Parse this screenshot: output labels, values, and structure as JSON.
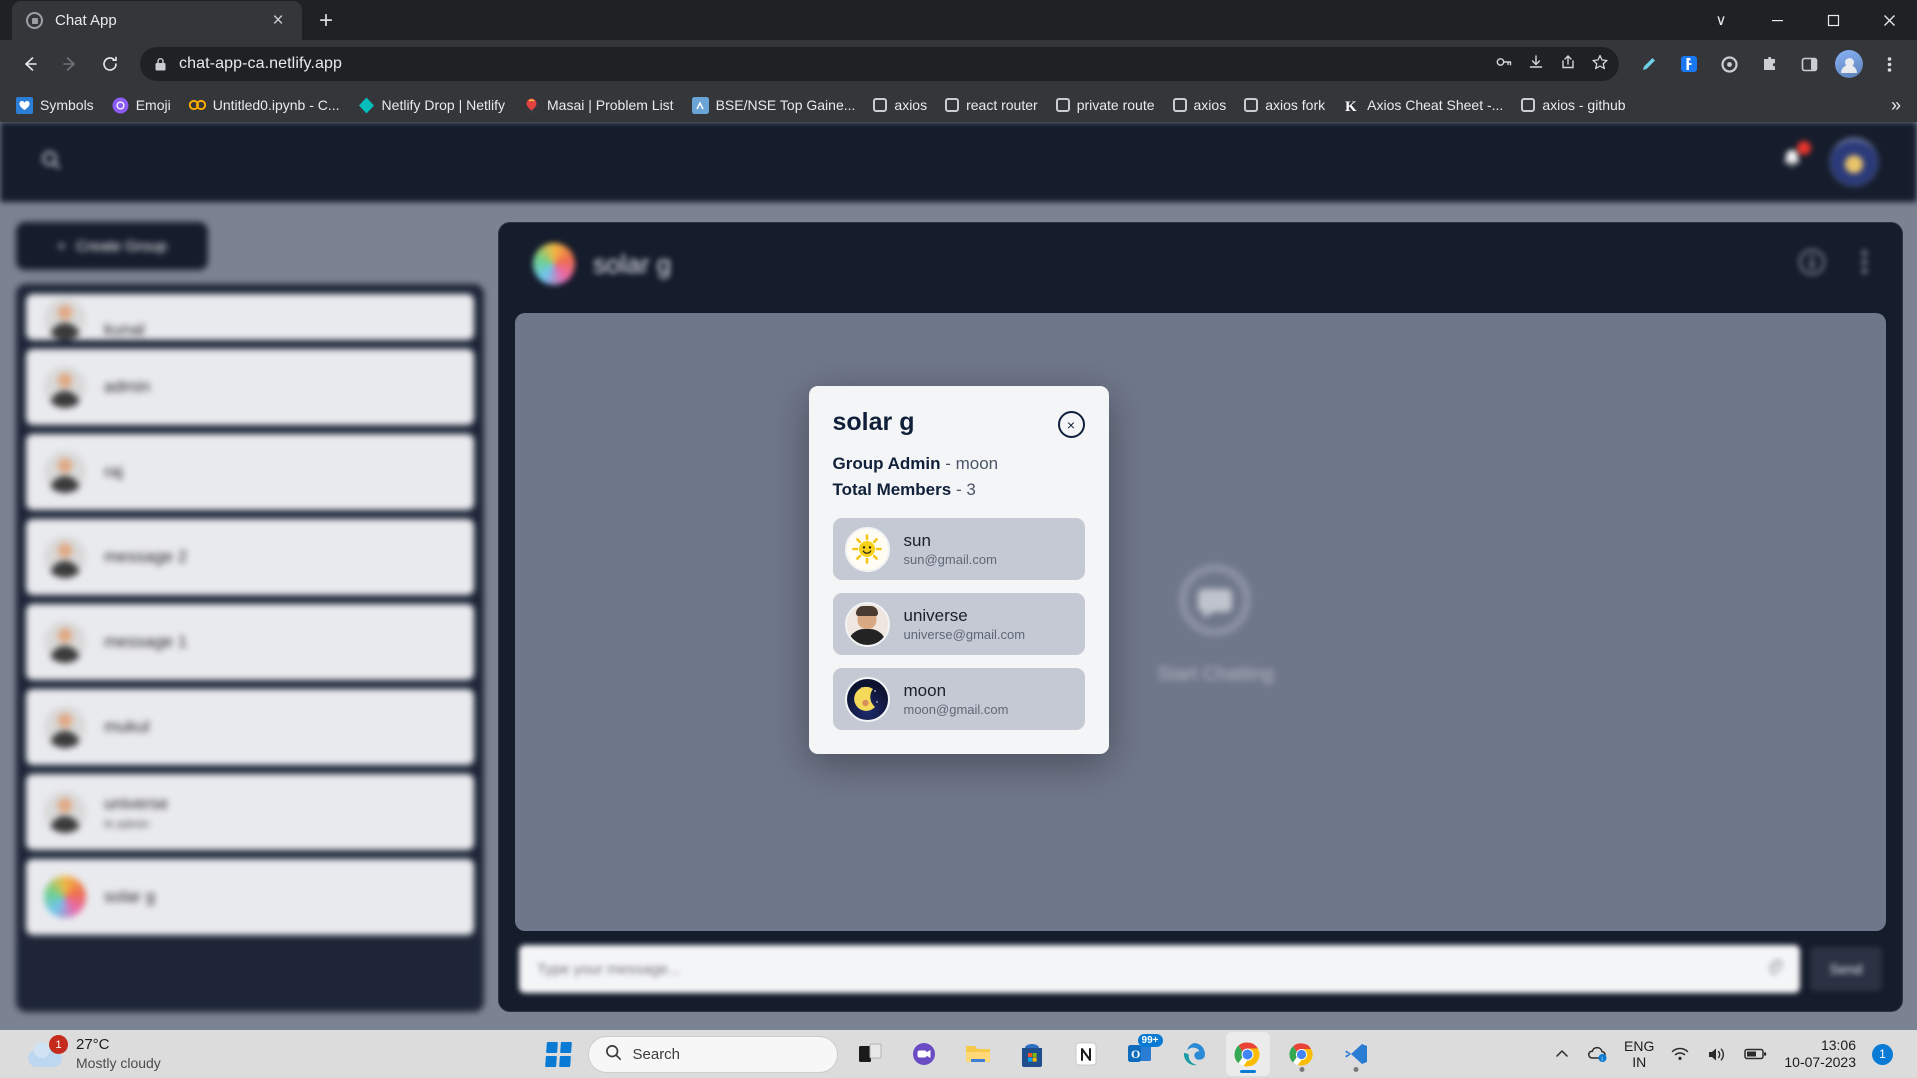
{
  "browser": {
    "tab": {
      "title": "Chat App",
      "favicon": "chat-favicon",
      "close_label": "×"
    },
    "new_tab_label": "+",
    "window_controls": {
      "minimize": "–",
      "maximize": "□",
      "close": "×",
      "collapse": "∨"
    },
    "nav": {
      "back": "←",
      "forward": "→",
      "reload": "↻"
    },
    "omnibox": {
      "url": "chat-app-ca.netlify.app",
      "lock_icon": "lock-icon"
    },
    "omni_icons": [
      "key-icon",
      "download-icon",
      "share-icon",
      "star-icon"
    ],
    "toolbar_icons": [
      "pen-icon",
      "forest-extension-icon",
      "gear-extension-icon",
      "puzzle-icon",
      "sidepanel-icon"
    ],
    "bookmarks": [
      {
        "label": "Symbols",
        "icon": "heart-icon",
        "icon_color": "#2c7fd6"
      },
      {
        "label": "Emoji",
        "icon": "emoji-icon",
        "icon_color": "#8b5cf6"
      },
      {
        "label": "Untitled0.ipynb - C...",
        "icon": "colab-icon",
        "icon_color": "#f9ab00"
      },
      {
        "label": "Netlify Drop | Netlify",
        "icon": "netlify-icon",
        "icon_color": "#05bdba"
      },
      {
        "label": "Masai | Problem List",
        "icon": "masai-icon",
        "icon_color": "#e2413f"
      },
      {
        "label": "BSE/NSE Top Gaine...",
        "icon": "stock-icon",
        "icon_color": "#4d8fd1"
      },
      {
        "label": "axios",
        "icon": "generic-bookmark-icon",
        "icon_color": "#c9cdd1"
      },
      {
        "label": "react router",
        "icon": "generic-bookmark-icon",
        "icon_color": "#c9cdd1"
      },
      {
        "label": "private route",
        "icon": "generic-bookmark-icon",
        "icon_color": "#c9cdd1"
      },
      {
        "label": "axios",
        "icon": "generic-bookmark-icon",
        "icon_color": "#c9cdd1"
      },
      {
        "label": "axios fork",
        "icon": "generic-bookmark-icon",
        "icon_color": "#c9cdd1"
      },
      {
        "label": "Axios Cheat Sheet -...",
        "icon": "kapeli-icon",
        "icon_color": "#ffffff"
      },
      {
        "label": "axios - github",
        "icon": "generic-bookmark-icon",
        "icon_color": "#c9cdd1"
      }
    ],
    "bookmarks_overflow": "»"
  },
  "app": {
    "header": {
      "search_icon": "search-icon",
      "notification_icon": "bell-icon",
      "notification_badge": "",
      "avatar": "user-avatar"
    },
    "sidebar": {
      "create_group_label": "Create Group",
      "create_group_icon": "plus-icon",
      "chats": [
        {
          "name": "kunal",
          "sub": "",
          "avatar": "generic"
        },
        {
          "name": "admin",
          "sub": "",
          "avatar": "generic"
        },
        {
          "name": "raj",
          "sub": "",
          "avatar": "generic"
        },
        {
          "name": "message 2",
          "sub": "",
          "avatar": "generic"
        },
        {
          "name": "message 1",
          "sub": "",
          "avatar": "generic"
        },
        {
          "name": "mukul",
          "sub": "",
          "avatar": "generic"
        },
        {
          "name": "universe",
          "sub": "hi admin",
          "avatar": "generic"
        },
        {
          "name": "solar g",
          "sub": "",
          "avatar": "solar"
        }
      ]
    },
    "chat": {
      "title": "solar g",
      "avatar": "solar-group-avatar",
      "info_icon": "info-icon",
      "menu_icon": "more-vertical-icon",
      "empty_state_label": "Start Chatting",
      "empty_state_icon": "chat-bubble-icon",
      "composer": {
        "placeholder": "Type your message...",
        "attach_icon": "paperclip-icon",
        "send_label": "Send"
      }
    },
    "modal": {
      "title": "solar g",
      "close_label": "×",
      "admin_label": "Group Admin",
      "admin_value": "- moon",
      "members_label": "Total Members",
      "members_value": "- 3",
      "members": [
        {
          "name": "sun",
          "email": "sun@gmail.com",
          "avatar": "sun",
          "glyph": "☀"
        },
        {
          "name": "universe",
          "email": "universe@gmail.com",
          "avatar": "universe",
          "glyph": ""
        },
        {
          "name": "moon",
          "email": "moon@gmail.com",
          "avatar": "moon",
          "glyph": "🌙"
        }
      ]
    }
  },
  "taskbar": {
    "weather": {
      "temp": "27°C",
      "desc": "Mostly cloudy",
      "badge": "1",
      "icon": "cloud-icon"
    },
    "start_label": "windows-start",
    "search_placeholder": "Search",
    "apps": [
      {
        "name": "task-view-icon",
        "badge": ""
      },
      {
        "name": "teams-icon",
        "badge": ""
      },
      {
        "name": "file-explorer-icon",
        "badge": ""
      },
      {
        "name": "microsoft-store-icon",
        "badge": ""
      },
      {
        "name": "notion-icon",
        "badge": ""
      },
      {
        "name": "outlook-icon",
        "badge": "99+"
      },
      {
        "name": "edge-icon",
        "badge": ""
      },
      {
        "name": "chrome-icon-active",
        "badge": ""
      },
      {
        "name": "chrome-icon-second",
        "badge": ""
      },
      {
        "name": "vscode-icon",
        "badge": ""
      }
    ],
    "tray": {
      "chevron": "^",
      "onedrive_icon": "onedrive-icon",
      "language_line1": "ENG",
      "language_line2": "IN",
      "wifi_icon": "wifi-icon",
      "volume_icon": "volume-icon",
      "battery_icon": "battery-icon",
      "time": "13:06",
      "date": "10-07-2023",
      "notification_count": "1"
    }
  }
}
